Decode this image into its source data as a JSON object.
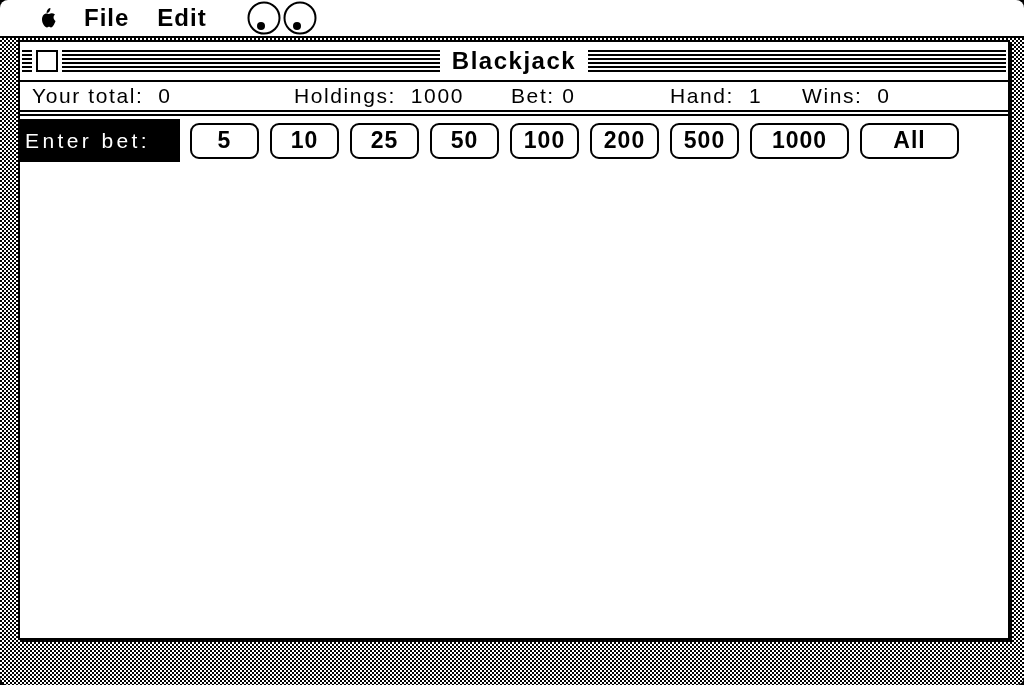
{
  "menu_bar": {
    "items": [
      {
        "label": "File"
      },
      {
        "label": "Edit"
      }
    ]
  },
  "window": {
    "title": "Blackjack",
    "status": [
      "Your total:  0",
      "Holdings:  1000",
      "Bet: 0",
      "Hand:  1",
      "Wins:  0"
    ],
    "bet_prompt": "Enter bet:",
    "bet_buttons": [
      "5",
      "10",
      "25",
      "50",
      "100",
      "200",
      "500",
      "1000",
      "All"
    ]
  }
}
